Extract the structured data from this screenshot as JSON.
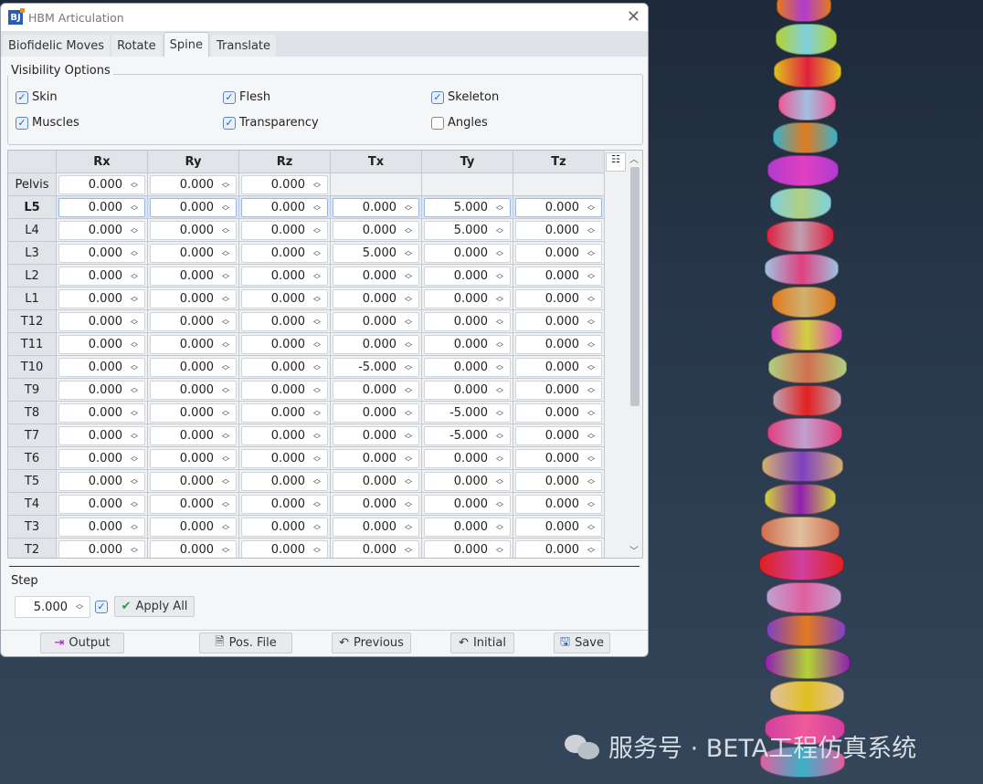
{
  "window": {
    "title": "HBM Articulation",
    "app_icon": "BJ"
  },
  "tabs": [
    {
      "label": "Biofidelic Moves"
    },
    {
      "label": "Rotate"
    },
    {
      "label": "Spine",
      "active": true
    },
    {
      "label": "Translate"
    }
  ],
  "visibility": {
    "label": "Visibility Options",
    "options": [
      {
        "label": "Skin",
        "checked": true
      },
      {
        "label": "Flesh",
        "checked": true
      },
      {
        "label": "Skeleton",
        "checked": true
      },
      {
        "label": "Muscles",
        "checked": true
      },
      {
        "label": "Transparency",
        "checked": true
      },
      {
        "label": "Angles",
        "checked": false
      }
    ]
  },
  "table": {
    "columns": [
      "Rx",
      "Ry",
      "Rz",
      "Tx",
      "Ty",
      "Tz"
    ],
    "selected_row": "L5",
    "rows": [
      {
        "label": "Pelvis",
        "values": [
          "0.000",
          "0.000",
          "0.000",
          null,
          null,
          null
        ]
      },
      {
        "label": "L5",
        "values": [
          "0.000",
          "0.000",
          "0.000",
          "0.000",
          "5.000",
          "0.000"
        ]
      },
      {
        "label": "L4",
        "values": [
          "0.000",
          "0.000",
          "0.000",
          "0.000",
          "5.000",
          "0.000"
        ]
      },
      {
        "label": "L3",
        "values": [
          "0.000",
          "0.000",
          "0.000",
          "5.000",
          "0.000",
          "0.000"
        ]
      },
      {
        "label": "L2",
        "values": [
          "0.000",
          "0.000",
          "0.000",
          "0.000",
          "0.000",
          "0.000"
        ]
      },
      {
        "label": "L1",
        "values": [
          "0.000",
          "0.000",
          "0.000",
          "0.000",
          "0.000",
          "0.000"
        ]
      },
      {
        "label": "T12",
        "values": [
          "0.000",
          "0.000",
          "0.000",
          "0.000",
          "0.000",
          "0.000"
        ]
      },
      {
        "label": "T11",
        "values": [
          "0.000",
          "0.000",
          "0.000",
          "0.000",
          "0.000",
          "0.000"
        ]
      },
      {
        "label": "T10",
        "values": [
          "0.000",
          "0.000",
          "0.000",
          "-5.000",
          "0.000",
          "0.000"
        ]
      },
      {
        "label": "T9",
        "values": [
          "0.000",
          "0.000",
          "0.000",
          "0.000",
          "0.000",
          "0.000"
        ]
      },
      {
        "label": "T8",
        "values": [
          "0.000",
          "0.000",
          "0.000",
          "0.000",
          "-5.000",
          "0.000"
        ]
      },
      {
        "label": "T7",
        "values": [
          "0.000",
          "0.000",
          "0.000",
          "0.000",
          "-5.000",
          "0.000"
        ]
      },
      {
        "label": "T6",
        "values": [
          "0.000",
          "0.000",
          "0.000",
          "0.000",
          "0.000",
          "0.000"
        ]
      },
      {
        "label": "T5",
        "values": [
          "0.000",
          "0.000",
          "0.000",
          "0.000",
          "0.000",
          "0.000"
        ]
      },
      {
        "label": "T4",
        "values": [
          "0.000",
          "0.000",
          "0.000",
          "0.000",
          "0.000",
          "0.000"
        ]
      },
      {
        "label": "T3",
        "values": [
          "0.000",
          "0.000",
          "0.000",
          "0.000",
          "0.000",
          "0.000"
        ]
      },
      {
        "label": "T2",
        "values": [
          "0.000",
          "0.000",
          "0.000",
          "0.000",
          "0.000",
          "0.000"
        ]
      }
    ]
  },
  "step": {
    "label": "Step",
    "value": "5.000",
    "checked": true,
    "apply_label": "Apply All"
  },
  "buttons": {
    "output": "Output",
    "pos_file": "Pos. File",
    "previous": "Previous",
    "initial": "Initial",
    "save": "Save"
  },
  "watermark": "服务号 · BETA工程仿真系统",
  "vertebra_colors": [
    "#e07b20",
    "#b3d335",
    "#e0c020",
    "#f05a9a",
    "#3bb0c9",
    "#b03bd0",
    "#7fd0e0",
    "#e02040",
    "#a0c0e0",
    "#e07b20",
    "#e040c0",
    "#b0d080",
    "#c0a0b0",
    "#e04080",
    "#d0b070",
    "#d0d040",
    "#d07050",
    "#e02020",
    "#c0a0d0",
    "#8040c0",
    "#9020b0",
    "#e0c0a0",
    "#d040a0",
    "#e060a0"
  ]
}
